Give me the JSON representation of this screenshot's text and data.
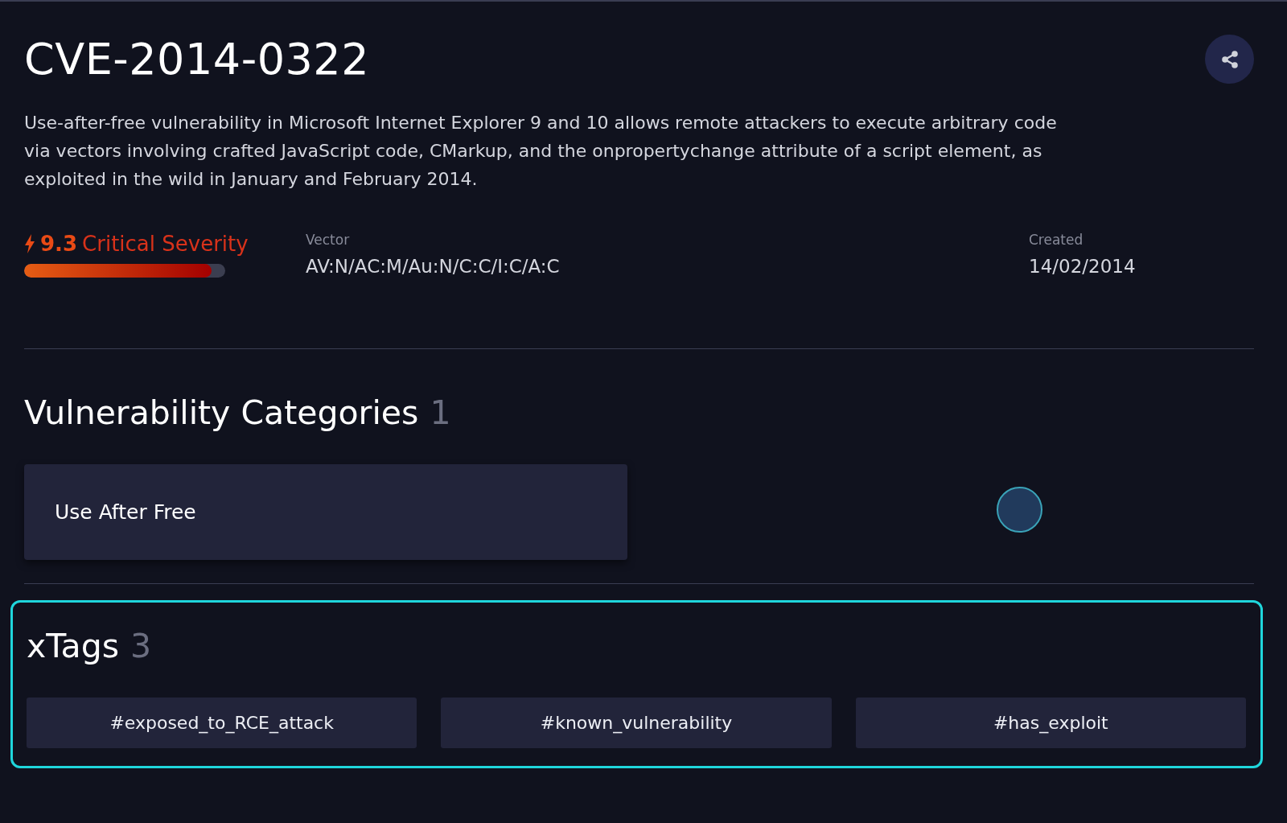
{
  "title": "CVE-2014-0322",
  "description": "Use-after-free vulnerability in Microsoft Internet Explorer 9 and 10 allows remote attackers to execute arbitrary code via vectors involving crafted JavaScript code, CMarkup, and the onpropertychange attribute of a script element, as exploited in the wild in January and February 2014.",
  "severity": {
    "score": "9.3",
    "label": "Critical Severity",
    "level": 0.93
  },
  "vector": {
    "label": "Vector",
    "value": "AV:N/AC:M/Au:N/C:C/I:C/A:C"
  },
  "created": {
    "label": "Created",
    "value": "14/02/2014"
  },
  "categories": {
    "heading": "Vulnerability Categories",
    "count": "1",
    "items": [
      "Use After Free"
    ]
  },
  "xtags": {
    "heading": "xTags",
    "count": "3",
    "highlighted": true,
    "items": [
      "#exposed_to_RCE_attack",
      "#known_vulnerability",
      "#has_exploit"
    ]
  }
}
